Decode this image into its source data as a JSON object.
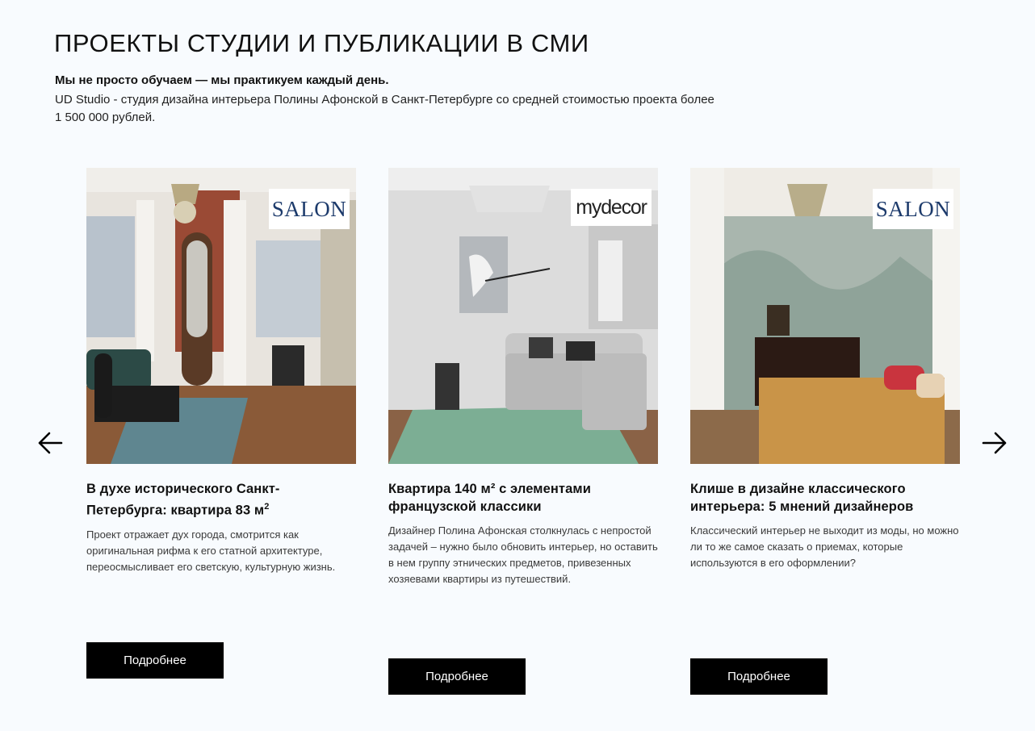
{
  "section": {
    "title": "ПРОЕКТЫ СТУДИИ И ПУБЛИКАЦИИ В СМИ",
    "lead_bold": "Мы не просто обучаем — мы практикуем каждый день.",
    "lead_text": "UD Studio - студия дизайна интерьера Полины Афонской в Санкт-Петербурге со средней стоимостью проекта более 1 500 000 рублей."
  },
  "carousel": {
    "prev_icon": "arrow-left-icon",
    "next_icon": "arrow-right-icon",
    "cards": [
      {
        "badge": "SALON",
        "title": "В духе исторического Санкт-Петербурга: квартира 83 м",
        "title_sup": "2",
        "description": "Проект отражает дух города, смотрится как оригинальная рифма к его статной архитектуре, переосмысливает его светскую, культурную жизнь.",
        "button": "Подробнее"
      },
      {
        "badge": "mydecor",
        "title": "Квартира 140 м² с элементами французской классики",
        "description": "Дизайнер Полина Афонская столкнулась с непростой задачей – нужно было обновить интерьер, но оставить в нем группу этнических предметов, привезенных хозяевами квартиры из путешествий.",
        "button": "Подробнее"
      },
      {
        "badge": "SALON",
        "title": "Клише в дизайне классического интерьера: 5 мнений дизайнеров",
        "description": "Классический интерьер не выходит из моды, но можно ли то же самое сказать о приемах, которые используются в его оформлении?",
        "button": "Подробнее"
      }
    ]
  },
  "colors": {
    "background": "#f8fbfe",
    "button": "#000000",
    "salon_logo": "#1c3a6b"
  }
}
